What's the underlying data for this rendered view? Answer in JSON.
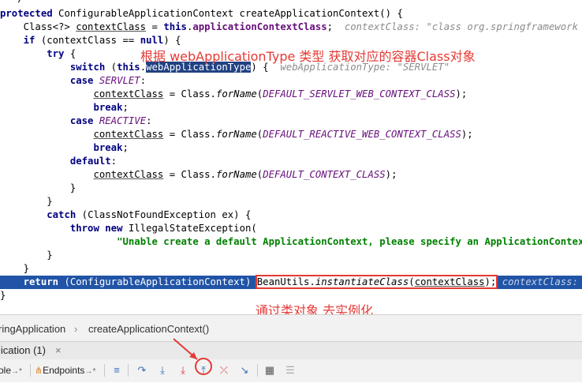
{
  "code": {
    "line0": "  */",
    "line1_kw": "protected",
    "line1_rest": " ConfigurableApplicationContext createApplicationContext() {",
    "line2_a": "    Class<?> ",
    "line2_var": "contextClass",
    "line2_b": " = ",
    "line2_this": "this",
    "line2_c": ".",
    "line2_field": "applicationContextClass",
    "line2_d": ";  ",
    "line2_hint": "contextClass: \"class org.springframework",
    "line3_kw": "if",
    "line3_a": " (contextClass == ",
    "line3_null": "null",
    "line3_b": ") {",
    "line4_kw": "try",
    "line4_rest": " {",
    "line5_kw": "switch",
    "line5_a": " (",
    "line5_this": "this",
    "line5_b": ".",
    "line5_sel": "webApplicationType",
    "line5_c": ") {  ",
    "line5_hint": "webApplicationType: \"SERVLET\"",
    "line6_kw": "case",
    "line6_val": "SERVLET",
    "line6_colon": ":",
    "line7_var": "contextClass",
    "line7_a": " = Class.",
    "line7_fn": "forName",
    "line7_b": "(",
    "line7_const": "DEFAULT_SERVLET_WEB_CONTEXT_CLASS",
    "line7_c": ");",
    "line8_kw": "break",
    "line8_rest": ";",
    "line9_kw": "case",
    "line9_val": "REACTIVE",
    "line9_colon": ":",
    "line10_var": "contextClass",
    "line10_a": " = Class.",
    "line10_fn": "forName",
    "line10_b": "(",
    "line10_const": "DEFAULT_REACTIVE_WEB_CONTEXT_CLASS",
    "line10_c": ");",
    "line11_kw": "break",
    "line11_rest": ";",
    "line12_kw": "default",
    "line12_rest": ":",
    "line13_var": "contextClass",
    "line13_a": " = Class.",
    "line13_fn": "forName",
    "line13_b": "(",
    "line13_const": "DEFAULT_CONTEXT_CLASS",
    "line13_c": ");",
    "line14": "}",
    "line15": "}",
    "line16_kw": "catch",
    "line16_rest": " (ClassNotFoundException ex) {",
    "line17_kw1": "throw",
    "line17_sp": " ",
    "line17_kw2": "new",
    "line17_rest": " IllegalStateException(",
    "line18_str": "\"Unable create a default ApplicationContext, please specify an ApplicationContextClass\"",
    "line19": "}",
    "line20": "}",
    "line21_kw": "return",
    "line21_a": " (ConfigurableApplicationContext) ",
    "line21_box_a": "BeanUtils.",
    "line21_box_fn": "instantiateClass",
    "line21_box_b": "(",
    "line21_box_var": "contextClass",
    "line21_box_c": ");",
    "line21_hint": " contextClass: \"class org.springframework",
    "line22": "}"
  },
  "annotations": {
    "top": "根据  webApplicationType 类型   获取对应的容器Class对象",
    "bottom": "通过类对象  去实例化"
  },
  "breadcrumb": {
    "item1": "ringApplication",
    "sep": "›",
    "item2": "createApplicationContext()"
  },
  "debug_tab": {
    "label": "lication (1)",
    "close": "×"
  },
  "toolbar": {
    "console_label": "ole",
    "endpoints_label": "Endpoints",
    "pin_suffix": "→*"
  },
  "colors": {
    "annotation": "#e53935",
    "exec_line": "#2154a6",
    "selection": "#214283"
  }
}
